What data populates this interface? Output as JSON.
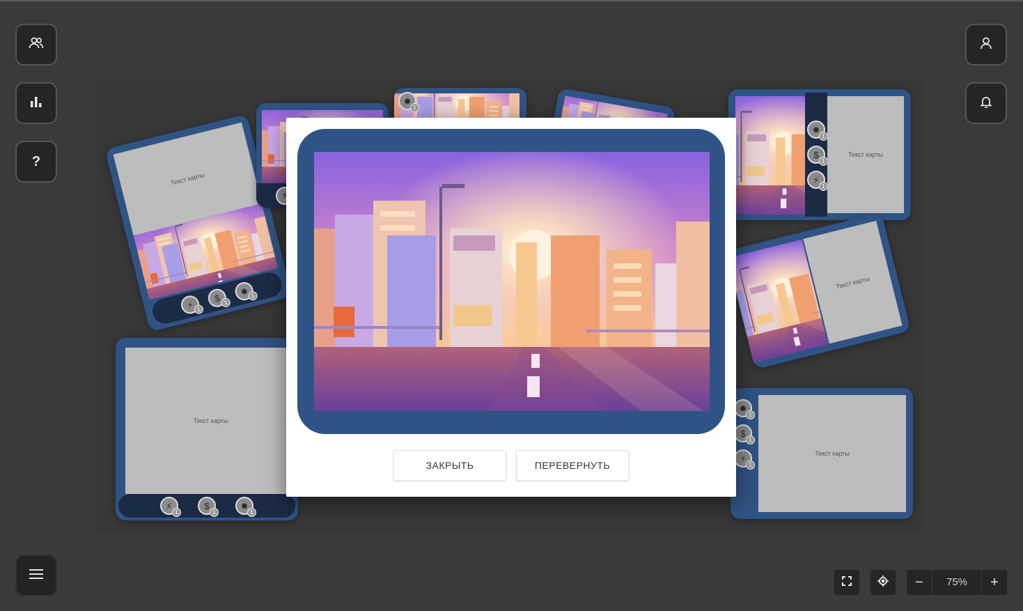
{
  "left_toolbar": {
    "players_icon": "players-icon",
    "stats_icon": "bar-chart-icon",
    "help_label": "?"
  },
  "right_toolbar": {
    "profile_icon": "user-icon",
    "notifications_icon": "bell-icon"
  },
  "menu_icon": "menu-icon",
  "card_text": "Текст карты",
  "resource_count": "1",
  "zoom": {
    "minus": "−",
    "value": "75%",
    "plus": "+"
  },
  "modal": {
    "close_label": "ЗАКРЫТЬ",
    "flip_label": "ПЕРЕВЕРНУТЬ"
  },
  "colors": {
    "background": "#3a3a3a",
    "card_frame": "#2f5384",
    "strip": "#1b2a45"
  }
}
